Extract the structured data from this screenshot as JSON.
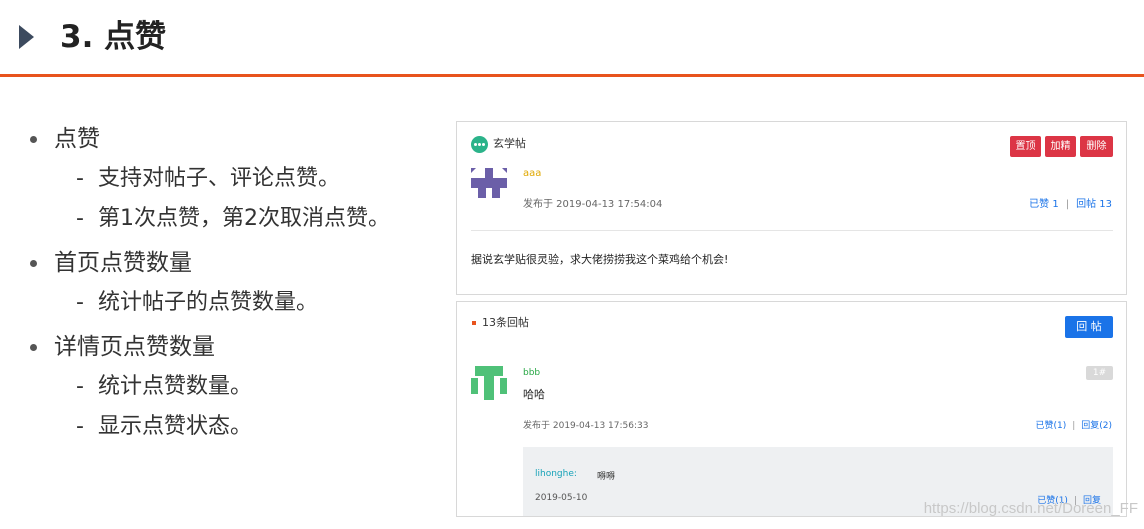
{
  "slide": {
    "title": "3. 点赞",
    "accent_color": "#e8531d"
  },
  "bullets": [
    {
      "label": "点赞",
      "subs": [
        "支持对帖子、评论点赞。",
        "第1次点赞，第2次取消点赞。"
      ]
    },
    {
      "label": "首页点赞数量",
      "subs": [
        "统计帖子的点赞数量。"
      ]
    },
    {
      "label": "详情页点赞数量",
      "subs": [
        "统计点赞数量。",
        "显示点赞状态。"
      ]
    }
  ],
  "sub_dash": "-",
  "post": {
    "board": "玄学帖",
    "buttons": {
      "top": "置顶",
      "fine": "加精",
      "delete": "删除"
    },
    "author": "aaa",
    "time": "发布于 2019-04-13 17:54:04",
    "likes": "已赞 1",
    "stats_sep": "|",
    "replies": "回帖 13",
    "content": "据说玄学贴很灵验，求大佬捞捞我这个菜鸡给个机会!"
  },
  "replies_section": {
    "count_label": "13条回帖",
    "reply_button": "回 帖",
    "reply": {
      "author": "bbb",
      "floor": "1#",
      "text": "哈哈",
      "time": "发布于 2019-04-13 17:56:33",
      "likes": "已赞(1)",
      "sep": "|",
      "reply_count": "回复(2)"
    },
    "comment": {
      "user": "lihonghe:",
      "text": "嘚嘚",
      "time": "2019-05-10",
      "likes": "已赞(1)",
      "sep": "|",
      "reply": "回复"
    }
  },
  "watermark": "https://blog.csdn.net/Doreen_FF"
}
